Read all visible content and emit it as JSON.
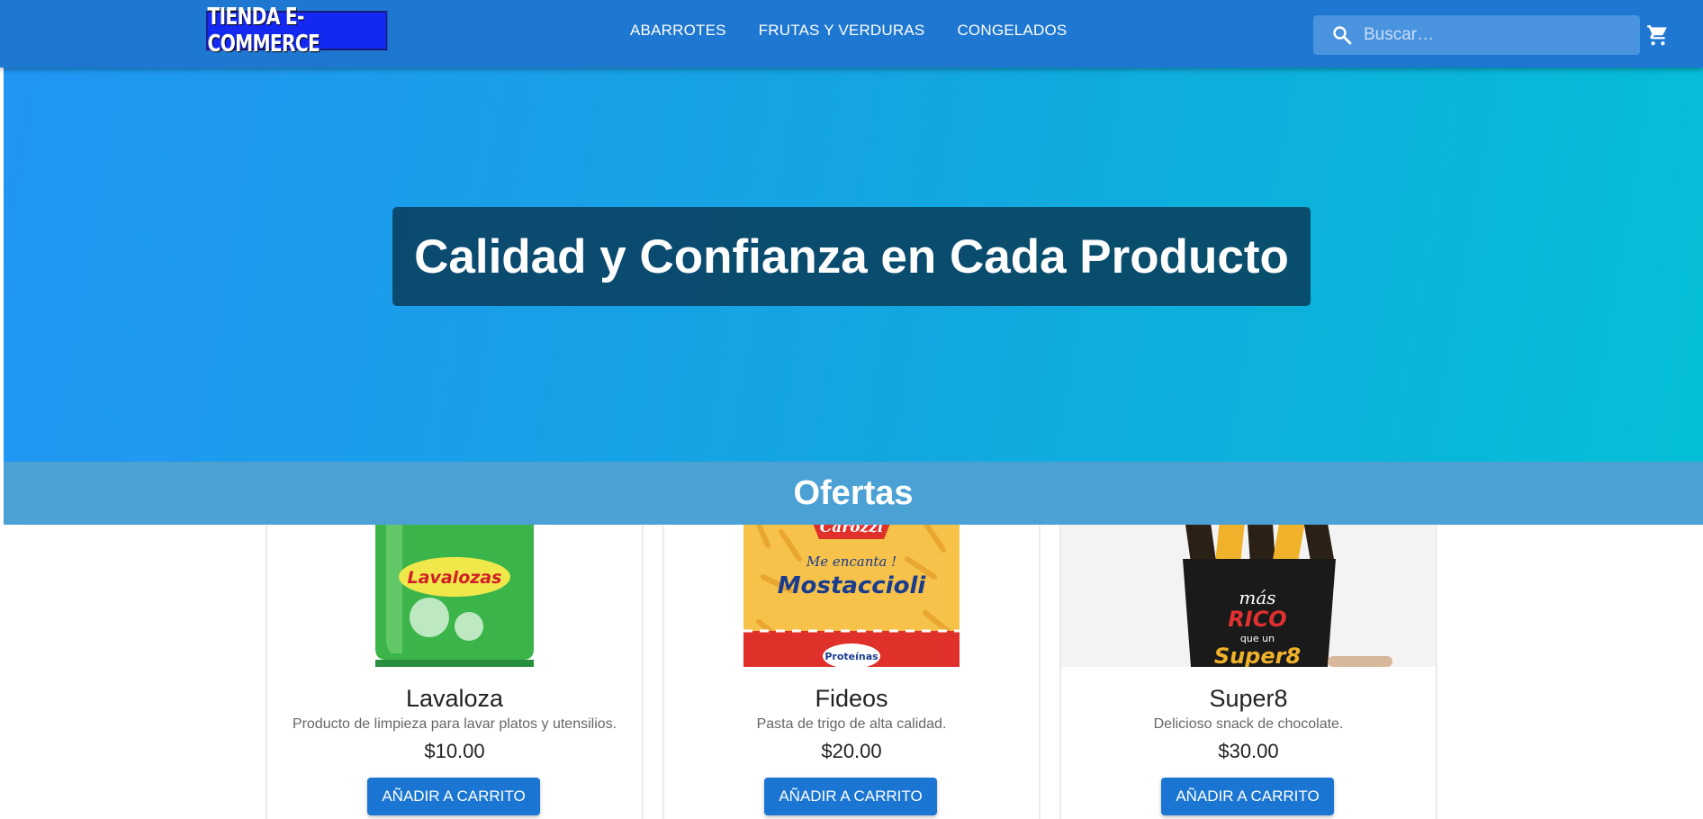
{
  "header": {
    "logo_text": "TIENDA E-COMMERCE",
    "nav": [
      {
        "label": "ABARROTES"
      },
      {
        "label": "FRUTAS Y VERDURAS"
      },
      {
        "label": "CONGELADOS"
      }
    ],
    "search": {
      "placeholder": "Buscar…",
      "icon": "search-icon"
    },
    "cart_icon": "cart-icon"
  },
  "hero": {
    "title": "Calidad y Confianza en Cada Producto"
  },
  "offers": {
    "title": "Ofertas"
  },
  "products": [
    {
      "name": "Lavaloza",
      "description": "Producto de limpieza para lavar platos y utensilios.",
      "price": "$10.00",
      "button": "AÑADIR A CARRITO",
      "image_text": "Lavalozas"
    },
    {
      "name": "Fideos",
      "description": "Pasta de trigo de alta calidad.",
      "price": "$20.00",
      "button": "AÑADIR A CARRITO",
      "image_text_brand": "Carozzi",
      "image_text_tag": "Me encanta !",
      "image_text_product": "Mostaccioli",
      "image_text_badge": "Proteínas"
    },
    {
      "name": "Super8",
      "description": "Delicioso snack de chocolate.",
      "price": "$30.00",
      "button": "AÑADIR A CARRITO",
      "image_text_top": "más",
      "image_text_mid": "RICO",
      "image_text_small": "que un",
      "image_text_bottom": "Super8"
    }
  ],
  "colors": {
    "topbar": "#1e77d1",
    "hero_start": "#2196f3",
    "hero_end": "#04bfd6",
    "offers_band": "#4ba1d4",
    "button": "#1a76d2"
  }
}
